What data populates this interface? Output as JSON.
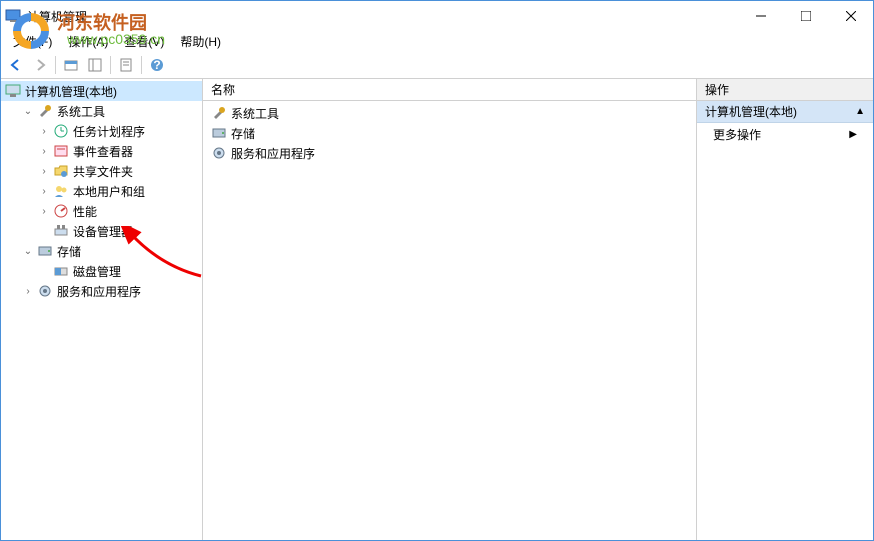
{
  "window": {
    "title": "计算机管理"
  },
  "menu": {
    "file": "文件(F)",
    "action": "操作(A)",
    "view": "查看(V)",
    "help": "帮助(H)"
  },
  "tree": {
    "root": "计算机管理(本地)",
    "system_tools": "系统工具",
    "task_scheduler": "任务计划程序",
    "event_viewer": "事件查看器",
    "shared_folders": "共享文件夹",
    "local_users": "本地用户和组",
    "performance": "性能",
    "device_manager": "设备管理器",
    "storage": "存储",
    "disk_mgmt": "磁盘管理",
    "services_apps": "服务和应用程序"
  },
  "mid": {
    "col_name": "名称",
    "item_system_tools": "系统工具",
    "item_storage": "存储",
    "item_services": "服务和应用程序"
  },
  "actions": {
    "header": "操作",
    "section": "计算机管理(本地)",
    "more": "更多操作"
  },
  "watermark": {
    "site_name": "河东软件园",
    "url": "www.pc0359.cn"
  }
}
